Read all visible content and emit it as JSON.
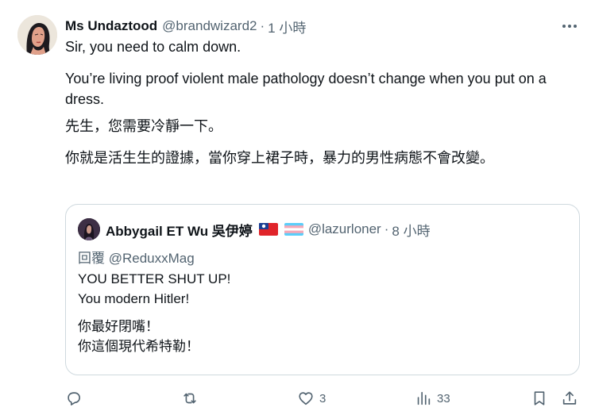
{
  "tweet": {
    "author": {
      "name": "Ms Undaztood",
      "handle": "@brandwizard2",
      "time": "1 小時"
    },
    "separator": "·",
    "text": {
      "line1": "Sir, you need to calm down.",
      "line2": "You’re living proof violent male pathology doesn’t change when you put on a dress.",
      "line3": "先生，您需要冷靜一下。",
      "line4": "你就是活生生的證據，當你穿上裙子時，暴力的男性病態不會改變。"
    },
    "more_icon": "more-horizontal-icon"
  },
  "quote": {
    "author": {
      "name": "Abbygail ET Wu 吳伊婷",
      "handle": "@lazurloner",
      "time": "8 小時"
    },
    "separator": "·",
    "flags": [
      "taiwan-flag-icon",
      "transgender-flag-icon"
    ],
    "reply_prefix": "回覆",
    "reply_to": "@ReduxxMag",
    "text": {
      "line1": "YOU BETTER SHUT UP!",
      "line2": "You modern Hitler!",
      "line3": "你最好閉嘴！",
      "line4": "你這個現代希特勒！"
    }
  },
  "actions": {
    "reply": {
      "icon": "reply-icon",
      "count": ""
    },
    "retweet": {
      "icon": "retweet-icon",
      "count": ""
    },
    "like": {
      "icon": "heart-icon",
      "count": "3"
    },
    "views": {
      "icon": "views-icon",
      "count": "33"
    },
    "bookmark": {
      "icon": "bookmark-icon"
    },
    "share": {
      "icon": "share-icon"
    }
  },
  "colors": {
    "text": "#0f1419",
    "secondary": "#536471",
    "border": "#cfd9de"
  }
}
